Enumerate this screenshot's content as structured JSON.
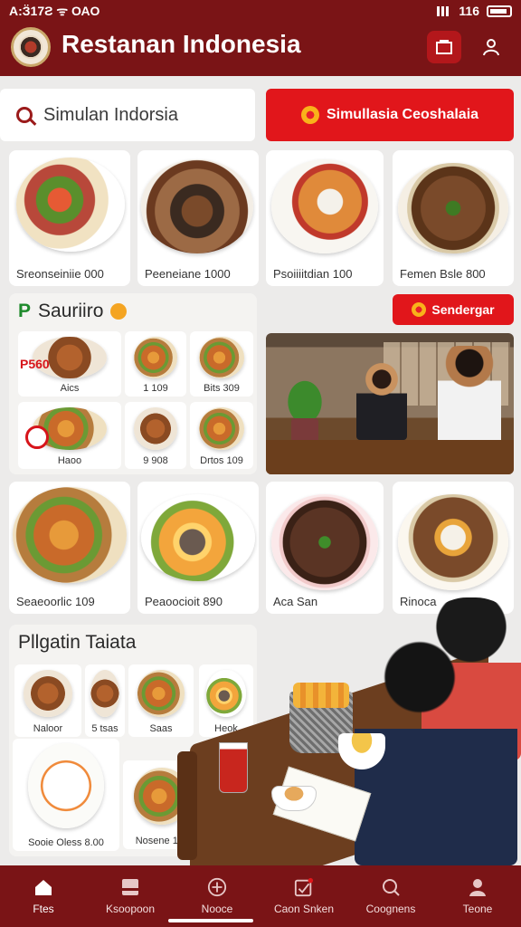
{
  "status": {
    "left": "A:Ӟ17Ƨ ᯤ ОАО",
    "right": "116"
  },
  "header": {
    "title": "Restanan Indonesia"
  },
  "search": {
    "label": "Simulan Indorsia",
    "cta_label": "Simullasia Ceoshalaia"
  },
  "top_cards": [
    {
      "caption": "Sreonseiniie  000"
    },
    {
      "caption": "Peeneiane  1000"
    },
    {
      "caption": "Psoiiiitdian  100"
    },
    {
      "caption": "Femen Bsle  800"
    }
  ],
  "section1": {
    "mark": "P",
    "title": "Sauriiro",
    "price_badge": "P560",
    "items": [
      {
        "label": "Aics"
      },
      {
        "label": "1  109"
      },
      {
        "label": "Bits  309"
      },
      {
        "label": "Haoo"
      },
      {
        "label": "9  908"
      },
      {
        "label": "Drtos  109"
      }
    ]
  },
  "section_cta": "Sendergar",
  "mid_cards": [
    {
      "caption": "Seaeoorlic  109"
    },
    {
      "caption": "Peaoocioit  890"
    },
    {
      "caption": "Aca San"
    },
    {
      "caption": "Rinoca"
    }
  ],
  "section2": {
    "title": "Pllgatin Taiata",
    "items": [
      {
        "label": "Naloor"
      },
      {
        "label": "5  tsas"
      },
      {
        "label": "Saas"
      },
      {
        "label": "Heok"
      },
      {
        "label": "Sooie Oless  8.00"
      },
      {
        "label": "Nosene  118"
      }
    ]
  },
  "bottom_nav": [
    {
      "label": "Ftes",
      "icon": "home-icon"
    },
    {
      "label": "Ksoopoon",
      "icon": "menu-icon"
    },
    {
      "label": "Nooce",
      "icon": "add-icon"
    },
    {
      "label": "Caon Snken",
      "icon": "orders-icon"
    },
    {
      "label": "Coognens",
      "icon": "search-icon"
    },
    {
      "label": "Teone",
      "icon": "profile-icon"
    }
  ],
  "colors": {
    "brand": "#7a1416",
    "accent": "#e1161b"
  }
}
